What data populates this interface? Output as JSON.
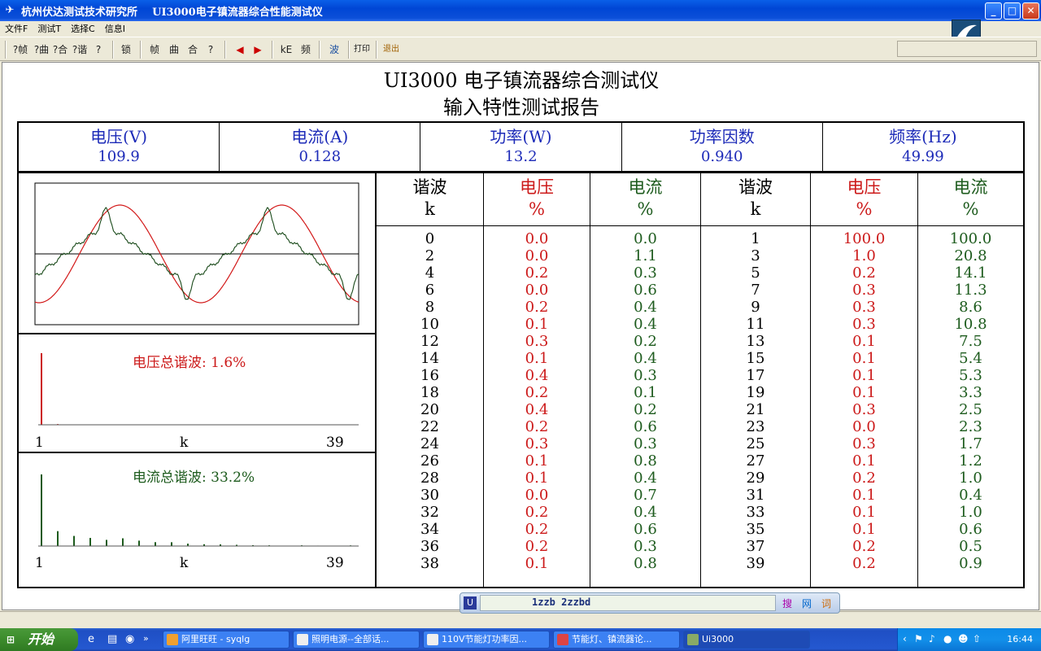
{
  "window": {
    "title": "杭州伏达测试技术研究所    UI3000电子镇流器综合性能测试仪"
  },
  "menu": [
    "文件F",
    "测试T",
    "选择C",
    "信息I"
  ],
  "toolbar": {
    "tools": [
      "?帧",
      "?曲",
      "?合",
      "?谐",
      "?",
      "锁",
      "帧",
      "曲",
      "合",
      "?",
      "◀",
      "▶",
      "kE",
      "频",
      "波",
      "打印",
      "退出"
    ]
  },
  "report": {
    "heading1": "UI3000 电子镇流器综合测试仪",
    "heading2": "输入特性测试报告",
    "summary": [
      {
        "label": "电压(V)",
        "value": "109.9"
      },
      {
        "label": "电流(A)",
        "value": "0.128"
      },
      {
        "label": "功率(W)",
        "value": "13.2"
      },
      {
        "label": "功率因数",
        "value": "0.940"
      },
      {
        "label": "频率(Hz)",
        "value": "49.99"
      }
    ],
    "vthd": {
      "label": "电压总谐波: 1.6%",
      "axis_left": "1",
      "axis_mid": "k",
      "axis_right": "39"
    },
    "ithd": {
      "label": "电流总谐波: 33.2%",
      "axis_left": "1",
      "axis_mid": "k",
      "axis_right": "39"
    },
    "table_headers": [
      {
        "top": "谐波",
        "bottom": "k"
      },
      {
        "top": "电压",
        "bottom": "%"
      },
      {
        "top": "电流",
        "bottom": "%"
      },
      {
        "top": "谐波",
        "bottom": "k"
      },
      {
        "top": "电压",
        "bottom": "%"
      },
      {
        "top": "电流",
        "bottom": "%"
      }
    ],
    "harmonics_even": {
      "k": [
        "0",
        "2",
        "4",
        "6",
        "8",
        "10",
        "12",
        "14",
        "16",
        "18",
        "20",
        "22",
        "24",
        "26",
        "28",
        "30",
        "32",
        "34",
        "36",
        "38"
      ],
      "voltage": [
        "0.0",
        "0.0",
        "0.2",
        "0.0",
        "0.2",
        "0.1",
        "0.3",
        "0.1",
        "0.4",
        "0.2",
        "0.4",
        "0.2",
        "0.3",
        "0.1",
        "0.1",
        "0.0",
        "0.2",
        "0.2",
        "0.2",
        "0.1"
      ],
      "current": [
        "0.0",
        "1.1",
        "0.3",
        "0.6",
        "0.4",
        "0.4",
        "0.2",
        "0.4",
        "0.3",
        "0.1",
        "0.2",
        "0.6",
        "0.3",
        "0.8",
        "0.4",
        "0.7",
        "0.4",
        "0.6",
        "0.3",
        "0.8"
      ]
    },
    "harmonics_odd": {
      "k": [
        "1",
        "3",
        "5",
        "7",
        "9",
        "11",
        "13",
        "15",
        "17",
        "19",
        "21",
        "23",
        "25",
        "27",
        "29",
        "31",
        "33",
        "35",
        "37",
        "39"
      ],
      "voltage": [
        "100.0",
        "1.0",
        "0.2",
        "0.3",
        "0.3",
        "0.3",
        "0.1",
        "0.1",
        "0.1",
        "0.1",
        "0.3",
        "0.0",
        "0.3",
        "0.1",
        "0.2",
        "0.1",
        "0.1",
        "0.1",
        "0.2",
        "0.2"
      ],
      "current": [
        "100.0",
        "20.8",
        "14.1",
        "11.3",
        "8.6",
        "10.8",
        "7.5",
        "5.4",
        "5.3",
        "3.3",
        "2.5",
        "2.3",
        "1.7",
        "1.2",
        "1.0",
        "0.4",
        "1.0",
        "0.6",
        "0.5",
        "0.9"
      ]
    },
    "voltage_spectrum": [
      100,
      1.0,
      0.2,
      0.3,
      0.3,
      0.3,
      0.1,
      0.1,
      0.1,
      0.1,
      0.3,
      0.0,
      0.3,
      0.1,
      0.2,
      0.1,
      0.1,
      0.1,
      0.2,
      0.2
    ],
    "current_spectrum": [
      100,
      20.8,
      14.1,
      11.3,
      8.6,
      10.8,
      7.5,
      5.4,
      5.3,
      3.3,
      2.5,
      2.3,
      1.7,
      1.2,
      1.0,
      0.4,
      1.0,
      0.6,
      0.5,
      0.9
    ]
  },
  "ime": {
    "text": "1zzb 2zzbd"
  },
  "taskbar": {
    "start": "开始",
    "tasks": [
      "阿里旺旺 - syqlg",
      "照明电源--全部话...",
      "110V节能灯功率因...",
      "节能灯、镇流器论...",
      "Ui3000"
    ],
    "clock": "16:44"
  },
  "colors": {
    "voltage": "#cc1a1a",
    "current": "#1d5b1d",
    "summary_text": "#1d2bb8"
  }
}
